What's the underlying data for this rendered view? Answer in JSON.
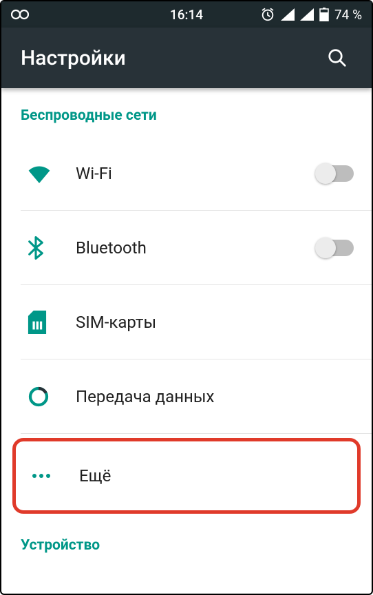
{
  "status": {
    "time": "16:14",
    "battery": "74 %"
  },
  "appbar": {
    "title": "Настройки"
  },
  "sections": {
    "wireless_header": "Беспроводные сети",
    "device_header": "Устройство"
  },
  "rows": {
    "wifi": "Wi-Fi",
    "bluetooth": "Bluetooth",
    "sim": "SIM-карты",
    "data": "Передача данных",
    "more": "Ещё"
  },
  "colors": {
    "accent": "#009788",
    "appbar": "#283238",
    "statusbar": "#1e2a2e",
    "highlight": "#e03a2a"
  }
}
